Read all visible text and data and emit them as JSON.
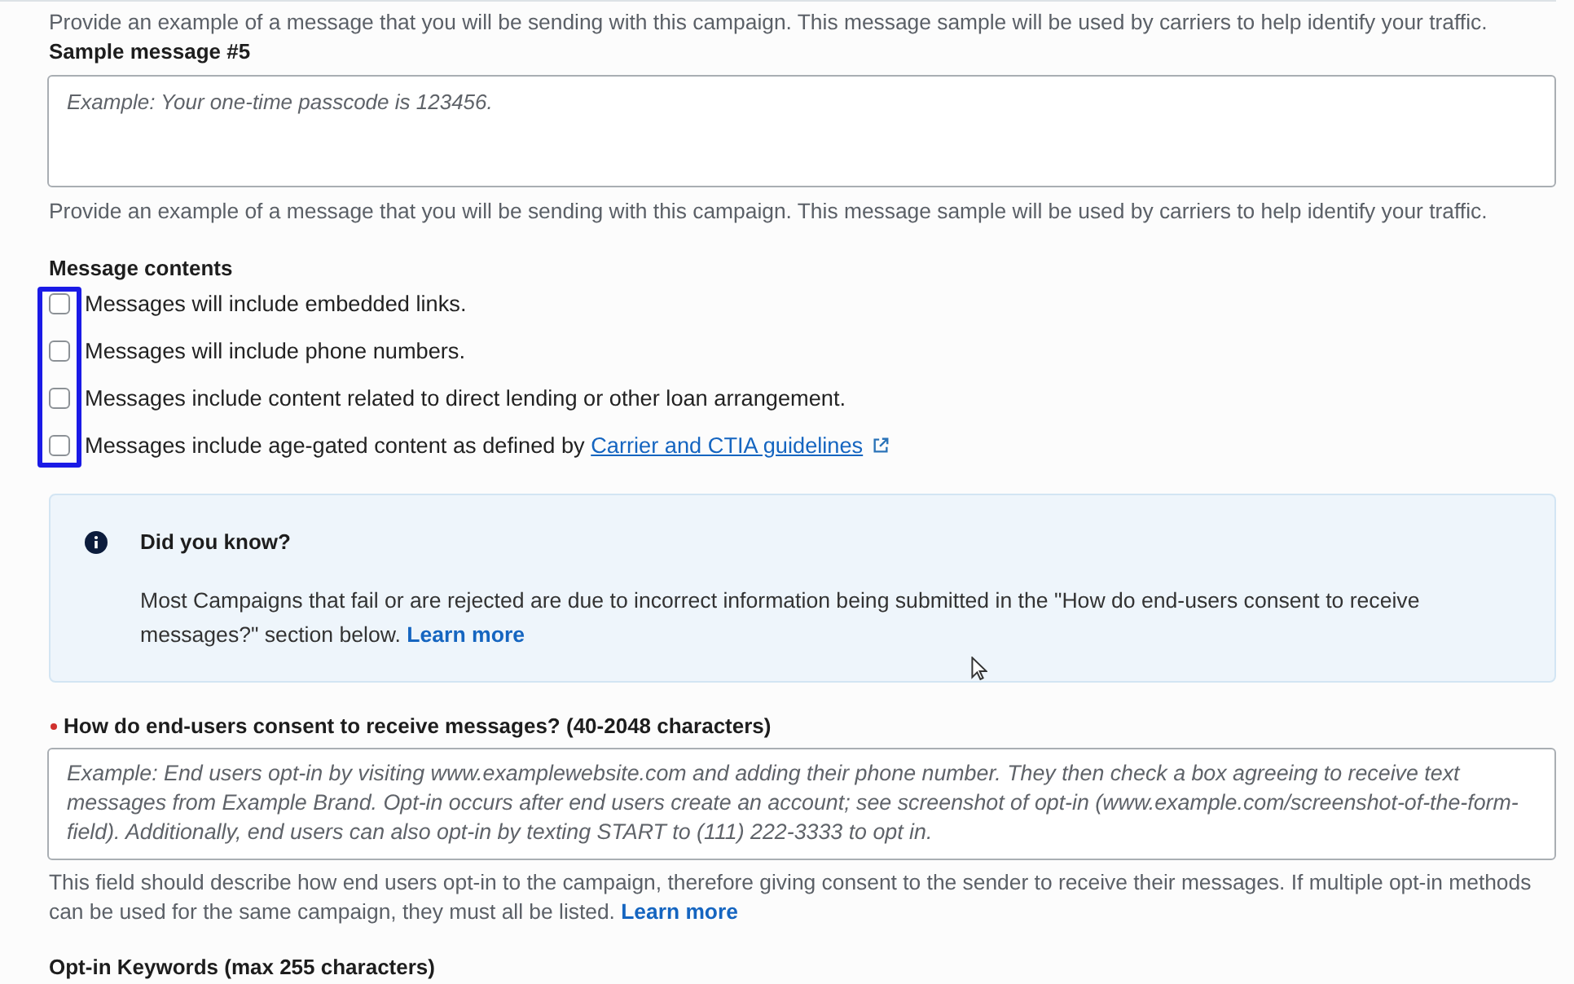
{
  "top_help": "Provide an example of a message that you will be sending with this campaign. This message sample will be used by carriers to help identify your traffic.",
  "sample_message": {
    "label": "Sample message #5",
    "placeholder": "Example: Your one-time passcode is 123456.",
    "help": "Provide an example of a message that you will be sending with this campaign. This message sample will be used by carriers to help identify your traffic."
  },
  "message_contents": {
    "label": "Message contents",
    "highlighted": true,
    "options": [
      {
        "label": "Messages will include embedded links.",
        "checked": false
      },
      {
        "label": "Messages will include phone numbers.",
        "checked": false
      },
      {
        "label": "Messages include content related to direct lending or other loan arrangement.",
        "checked": false
      },
      {
        "label": "Messages include age-gated content as defined by",
        "link": "Carrier and CTIA guidelines",
        "checked": false
      }
    ]
  },
  "info": {
    "title": "Did you know?",
    "body": "Most Campaigns that fail or are rejected are due to incorrect information being submitted in the \"How do end-users consent to receive messages?\" section below.",
    "link": "Learn more"
  },
  "consent": {
    "label": "How do end-users consent to receive messages? (40-2048 characters)",
    "required": true,
    "placeholder": "Example: End users opt-in by visiting www.examplewebsite.com and adding their phone number. They then check a box agreeing to receive text messages from Example Brand. Opt-in occurs after end users create an account; see screenshot of opt-in (www.example.com/screenshot-of-the-form-field). Additionally, end users can also opt-in by texting START to (111) 222-3333 to opt in.",
    "help": "This field should describe how end users opt-in to the campaign, therefore giving consent to the sender to receive their messages. If multiple opt-in methods can be used for the same campaign, they must all be listed.",
    "link": "Learn more"
  },
  "opt_in_keywords": {
    "label": "Opt-in Keywords (max 255 characters)"
  }
}
